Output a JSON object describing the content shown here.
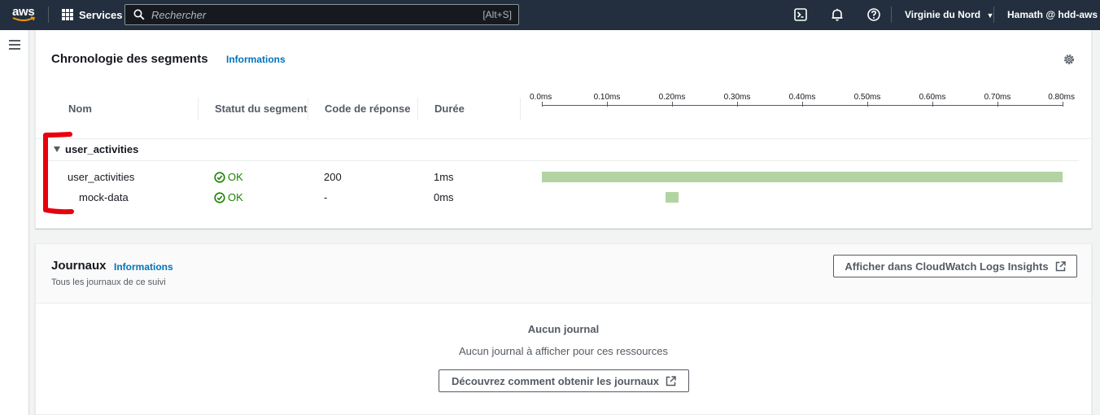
{
  "topnav": {
    "logo_text": "aws",
    "services_label": "Services",
    "search_placeholder": "Rechercher",
    "search_shortcut": "[Alt+S]",
    "region": "Virginie du Nord",
    "account": "Hamath @ hdd-aws",
    "icons": [
      "cloudshell-icon",
      "bell-icon",
      "help-icon"
    ]
  },
  "segments_panel": {
    "title": "Chronologie des segments",
    "info_link": "Informations",
    "columns": [
      "Nom",
      "Statut du segment",
      "Code de réponse",
      "Durée"
    ],
    "timeline_ticks": [
      "0.0ms",
      "0.10ms",
      "0.20ms",
      "0.30ms",
      "0.40ms",
      "0.50ms",
      "0.60ms",
      "0.70ms",
      "0.80ms"
    ],
    "group": {
      "label": "user_activities",
      "expanded": true
    },
    "rows": [
      {
        "name": "user_activities",
        "status": "OK",
        "code": "200",
        "duration": "1ms",
        "start_ms": 0.0,
        "end_ms": 0.8
      },
      {
        "name": "mock-data",
        "status": "OK",
        "code": "-",
        "duration": "0ms",
        "start_ms": 0.19,
        "end_ms": 0.21
      }
    ],
    "bar_color": "#b3d3a3",
    "annotation_color": "#e8000d"
  },
  "logs_panel": {
    "title": "Journaux",
    "info_link": "Informations",
    "subtitle": "Tous les journaux de ce suivi",
    "cloudwatch_button": "Afficher dans CloudWatch Logs Insights",
    "empty_title": "Aucun journal",
    "empty_text": "Aucun journal à afficher pour ces ressources",
    "learn_button": "Découvrez comment obtenir les journaux"
  },
  "colors": {
    "nav_bg": "#232f3e",
    "link": "#0073bb",
    "ok_green": "#1d8102"
  }
}
